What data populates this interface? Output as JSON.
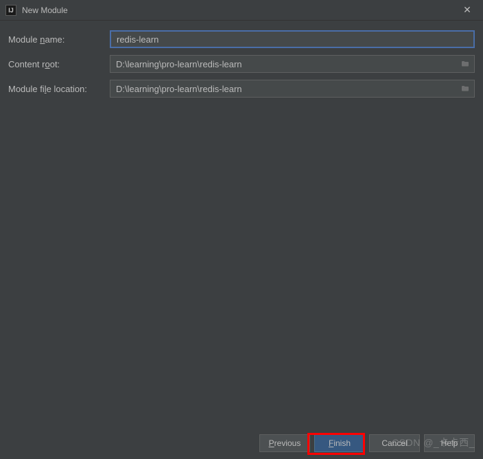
{
  "titlebar": {
    "title": "New Module"
  },
  "form": {
    "moduleName": {
      "label_pre": "Module ",
      "label_mn": "n",
      "label_post": "ame:",
      "value": "redis-learn"
    },
    "contentRoot": {
      "label_pre": "Content r",
      "label_mn": "o",
      "label_post": "ot:",
      "value": "D:\\learning\\pro-learn\\redis-learn"
    },
    "moduleFileLocation": {
      "label_pre": "Module fi",
      "label_mn": "l",
      "label_post": "e location:",
      "value": "D:\\learning\\pro-learn\\redis-learn"
    }
  },
  "buttons": {
    "previous": {
      "mn": "P",
      "rest": "revious"
    },
    "finish": {
      "mn": "F",
      "rest": "inish"
    },
    "cancel": {
      "text": "Cancel"
    },
    "help": {
      "text": "Help"
    }
  },
  "watermark": "CSDN @_卡卡西_"
}
